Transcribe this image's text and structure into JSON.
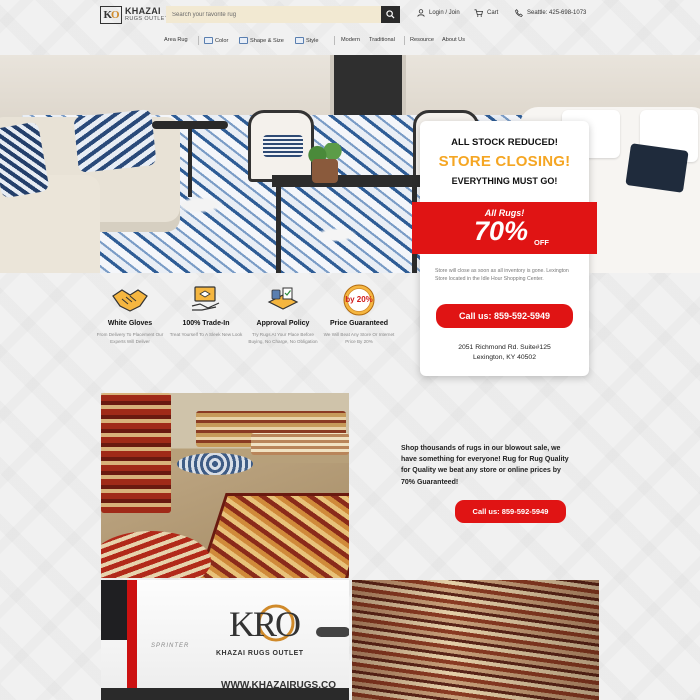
{
  "header": {
    "logo_main": "KHAZAI",
    "logo_sub": "RUGS OUTLET",
    "logo_mark_left": "K",
    "logo_mark_right": "O",
    "search_placeholder": "Search your favorite rug",
    "login_label": "Login / Join",
    "cart_label": "Cart",
    "phone_label": "Seattle: 425-698-1073"
  },
  "nav": {
    "items": [
      "Area Rug",
      "Color",
      "Shape & Size",
      "Style",
      "Modern",
      "Traditional",
      "Resource",
      "About Us"
    ]
  },
  "promo": {
    "line1": "ALL STOCK REDUCED!",
    "line2": "STORE CLOSING!",
    "line3": "EVERYTHING MUST GO!",
    "banner_all": "All Rugs!",
    "banner_pct": "70%",
    "banner_off": "OFF",
    "info": "Store will close as soon as all inventory is gone. Lexington Store located in the Idle Hour Shopping Center.",
    "call_label": "Call us: 859-592-5949",
    "address_line1": "2051 Richmond Rd. Suite#125",
    "address_line2": "Lexington, KY 40502"
  },
  "features": [
    {
      "title": "White Gloves",
      "desc": "From Delivery To Placement Our Experts Will Deliver",
      "icon": "handshake-icon"
    },
    {
      "title": "100% Trade-In",
      "desc": "Treat Yourself To A Sleek New Look",
      "icon": "trade-in-icon"
    },
    {
      "title": "Approval Policy",
      "desc": "Try Rugs At Your Place Before Buying, No Charge, No Obligation",
      "icon": "approval-icon"
    },
    {
      "title": "Price Guaranteed",
      "desc": "We Will Beat Any Store Or Internet Price By 20%",
      "icon": "price-badge-icon",
      "badge": "by 20%"
    }
  ],
  "showroom": {
    "text": "Shop thousands of rugs in our blowout sale, we have something for everyone! Rug for Rug Quality for Quality we beat any store or online prices by 70% Guaranteed!",
    "call_label": "Call us: 859-592-5949"
  },
  "van": {
    "logo_mark_left": "K",
    "logo_mark_right": "RO",
    "logo_text": "KHAZAI RUGS OUTLET",
    "url": "WWW.KHAZAIRUGS.CO",
    "sprinter": "SPRINTER"
  },
  "colors": {
    "accent_red": "#e01414",
    "accent_orange": "#f5a623",
    "search_bg": "#f2e9d2"
  }
}
